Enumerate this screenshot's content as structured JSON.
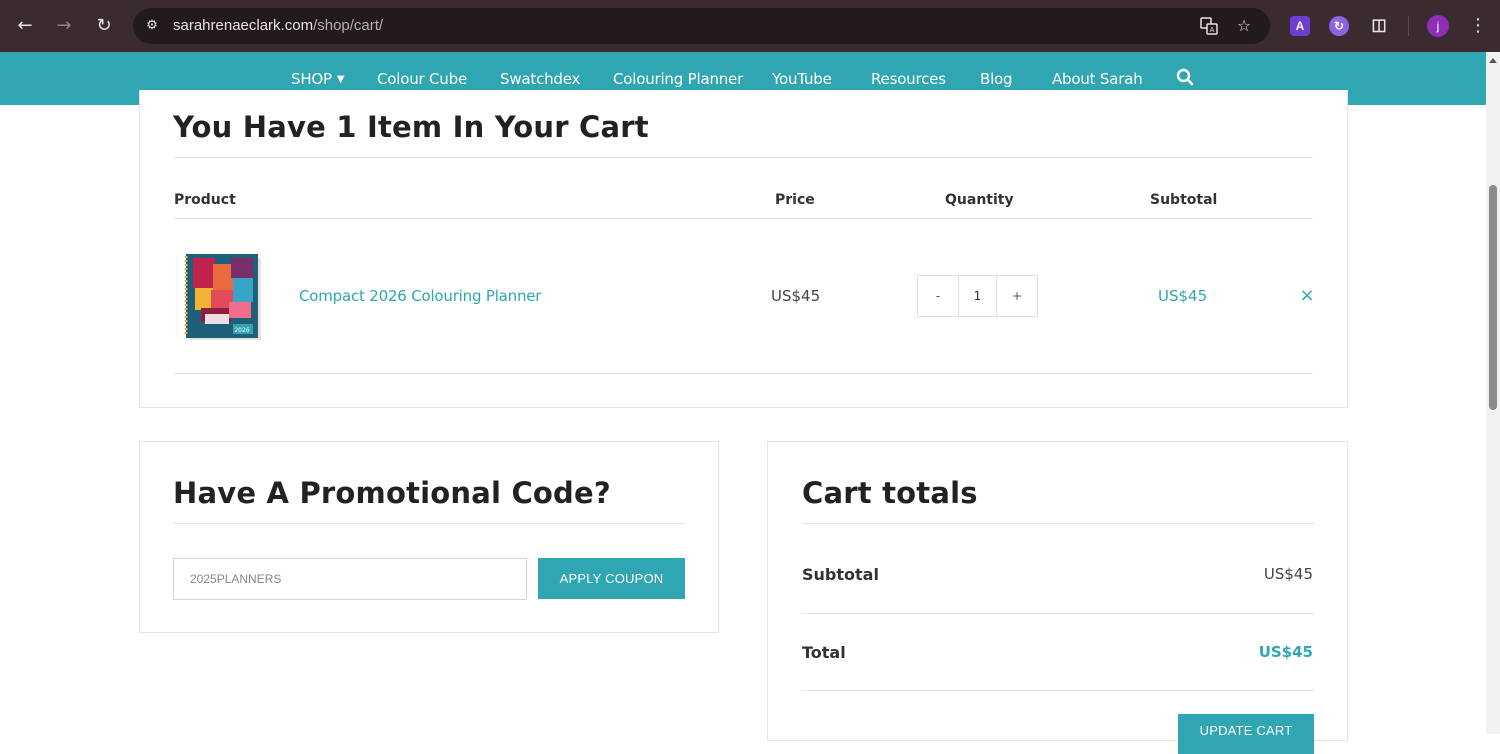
{
  "browser": {
    "url_host": "sarahrenaeclark.com",
    "url_path": "/shop/cart/",
    "back_icon": "arrow-left-icon",
    "forward_icon": "arrow-right-icon",
    "reload_icon": "reload-icon",
    "profile_initial": "j",
    "ext_a_label": "A"
  },
  "nav": {
    "items": [
      {
        "label": "SHOP"
      },
      {
        "label": "Colour Cube"
      },
      {
        "label": "Swatchdex"
      },
      {
        "label": "Colouring Planner"
      },
      {
        "label": "YouTube"
      },
      {
        "label": "Resources"
      },
      {
        "label": "Blog"
      },
      {
        "label": "About Sarah"
      }
    ]
  },
  "cart": {
    "heading": "You Have 1 Item In Your Cart",
    "columns": [
      "Product",
      "Price",
      "Quantity",
      "Subtotal"
    ],
    "items": [
      {
        "name": "Compact 2026 Colouring Planner",
        "price": "US$45",
        "quantity": "1",
        "subtotal": "US$45",
        "image_caption": "2026"
      }
    ],
    "qty_minus": "-",
    "qty_plus": "+",
    "remove_symbol": "×"
  },
  "promo": {
    "heading": "Have A Promotional Code?",
    "input_value": "2025PLANNERS",
    "apply_label": "APPLY COUPON"
  },
  "totals": {
    "heading": "Cart totals",
    "subtotal_label": "Subtotal",
    "subtotal_value": "US$45",
    "total_label": "Total",
    "total_value": "US$45",
    "update_label": "UPDATE CART"
  },
  "colors": {
    "brand_teal": "#2fa6b1",
    "chrome_bg": "#3a2b2f"
  }
}
